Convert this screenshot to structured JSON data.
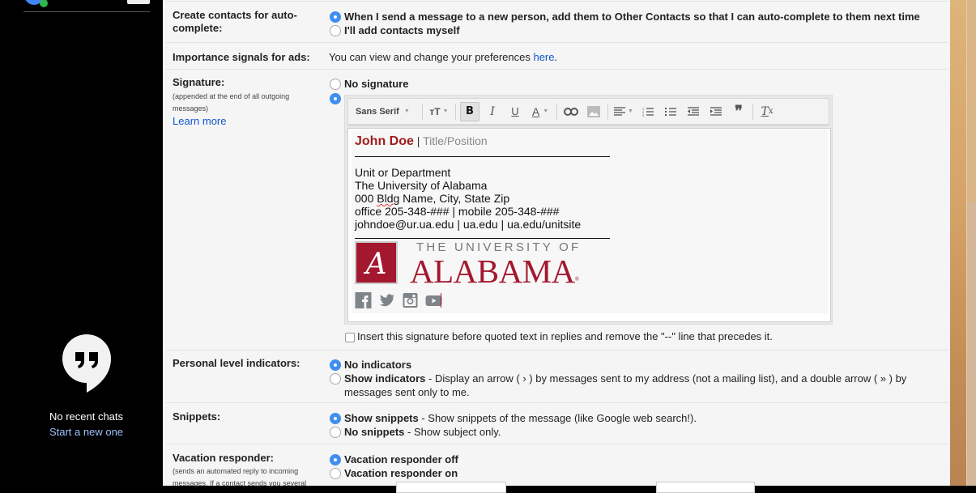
{
  "hangouts": {
    "no_chats": "No recent chats",
    "start_new": "Start a new one"
  },
  "settings": {
    "autocomplete": {
      "label": "Create contacts for auto-complete:",
      "options": [
        {
          "label": "When I send a message to a new person, add them to Other Contacts so that I can auto-complete to them next time",
          "selected": true
        },
        {
          "label": "I'll add contacts myself",
          "selected": false
        }
      ]
    },
    "ads": {
      "label": "Importance signals for ads:",
      "text": "You can view and change your preferences ",
      "link": "here",
      "after": "."
    },
    "signature": {
      "label": "Signature:",
      "sublabel": "(appended at the end of all outgoing messages)",
      "learn_more": "Learn more",
      "no_signature": "No signature",
      "toolbar": {
        "font": "Sans Serif",
        "tools": [
          "text-size",
          "bold",
          "italic",
          "underline",
          "text-color",
          "link",
          "image",
          "align",
          "numbered-list",
          "bulleted-list",
          "indent-less",
          "indent-more",
          "quote",
          "remove-formatting"
        ]
      },
      "content": {
        "name": "John Doe",
        "separator": " | ",
        "title": "Title/Position",
        "lines": [
          "Unit or Department",
          "The University of Alabama",
          "000 Bldg Name, City, State Zip",
          "office 205-348-### | mobile 205-348-###",
          "johndoe@ur.ua.edu | ua.edu | ua.edu/unitsite"
        ],
        "logo_top": "THE UNIVERSITY OF",
        "logo_main": "ALABAMA",
        "logo_mark": "®",
        "social": [
          "facebook",
          "twitter",
          "instagram",
          "youtube"
        ]
      },
      "insert_before": "Insert this signature before quoted text in replies and remove the \"--\" line that precedes it."
    },
    "indicators": {
      "label": "Personal level indicators:",
      "no": "No indicators",
      "show": "Show indicators",
      "show_desc": " - Display an arrow ( › ) by messages sent to my address (not a mailing list), and a double arrow ( » ) by messages sent only to me."
    },
    "snippets": {
      "label": "Snippets:",
      "show": "Show snippets",
      "show_desc": " - Show snippets of the message (like Google web search!).",
      "no": "No snippets",
      "no_desc": " - Show subject only."
    },
    "vacation": {
      "label": "Vacation responder:",
      "sublabel": "(sends an automated reply to incoming messages. If a contact sends you several",
      "off": "Vacation responder off",
      "on": "Vacation responder on"
    }
  },
  "colors": {
    "accent": "#3f8ef0",
    "link": "#1155cc",
    "crimson": "#9e1b32"
  }
}
